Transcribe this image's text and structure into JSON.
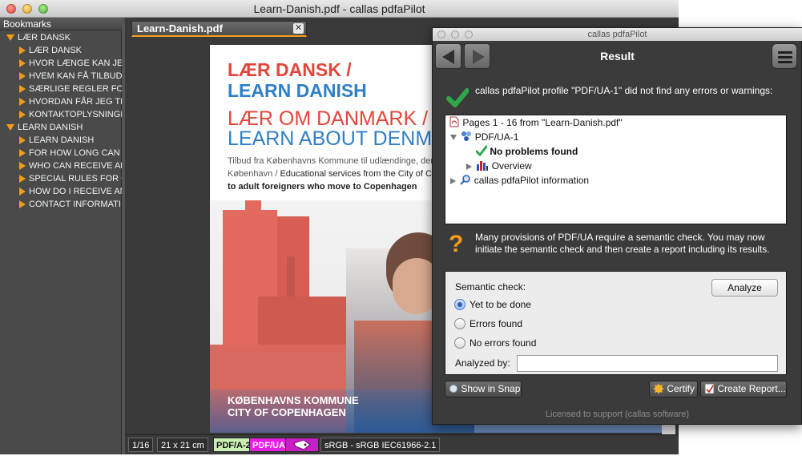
{
  "main_window": {
    "title": "Learn-Danish.pdf - callas pdfaPilot"
  },
  "bookmarks": {
    "header": "Bookmarks",
    "items": [
      {
        "label": "LÆR DANSK",
        "level": 0,
        "expanded": true
      },
      {
        "label": "LÆR DANSK",
        "level": 1,
        "expanded": false
      },
      {
        "label": "HVOR LÆNGE KAN JEG",
        "level": 1,
        "expanded": false
      },
      {
        "label": "HVEM KAN FÅ TILBUD",
        "level": 1,
        "expanded": false
      },
      {
        "label": "SÆRLIGE REGLER FOR",
        "level": 1,
        "expanded": false
      },
      {
        "label": "HVORDAN FÅR JEG TI",
        "level": 1,
        "expanded": false
      },
      {
        "label": "KONTAKTOPLYSNINGI",
        "level": 1,
        "expanded": false
      },
      {
        "label": "LEARN DANISH",
        "level": 0,
        "expanded": true
      },
      {
        "label": "LEARN DANISH",
        "level": 1,
        "expanded": false
      },
      {
        "label": "FOR HOW LONG CAN",
        "level": 1,
        "expanded": false
      },
      {
        "label": "WHO CAN RECEIVE AN",
        "level": 1,
        "expanded": false
      },
      {
        "label": "SPECIAL RULES FOR C",
        "level": 1,
        "expanded": false
      },
      {
        "label": "HOW DO I RECEIVE AN",
        "level": 1,
        "expanded": false
      },
      {
        "label": "CONTACT INFORMATI",
        "level": 1,
        "expanded": false
      }
    ]
  },
  "document": {
    "tab_label": "Learn-Danish.pdf",
    "tab_close": "✕",
    "page": {
      "title_line1": "LÆR DANSK /",
      "title_line2": "LEARN DANISH",
      "sub_line1": "LÆR OM DANMARK /",
      "sub_line2": "LEARN ABOUT DENMA",
      "body_line1": "Tilbud fra Københavns Kommune til udlændinge, der fl",
      "body_line2_a": "København / ",
      "body_line2_b": "Educational services from the City of Co",
      "body_line3": "to adult foreigners who move to Copenhagen",
      "kommune_line1": "KØBENHAVNS KOMMUNE",
      "kommune_line2": "CITY OF COPENHAGEN"
    },
    "colors": {
      "title_red": "#e2453c",
      "title_blue": "#2f7fc7",
      "photo_red": "#e26a5f"
    }
  },
  "status_bar": {
    "page": "1/16",
    "size": "21 x 21 cm",
    "badge_pdfa": "PDF/A-2a",
    "badge_pdfua": "PDF/UA-1",
    "color_profile": "sRGB - sRGB IEC61966-2.1",
    "colors": {
      "pdfa_bg": "#c8f0b4",
      "pdfua_bg": "#e41fe0",
      "tag_bg": "#c81ec4"
    }
  },
  "dialog": {
    "window_title": "callas pdfaPilot",
    "header_title": "Result",
    "success_message": "callas pdfaPilot profile \"PDF/UA-1\" did not find any errors or warnings:",
    "tree": [
      {
        "label": "Pages 1 - 16 from \"Learn-Danish.pdf\"",
        "icon": "pdf-file-icon"
      },
      {
        "label": "PDF/UA-1",
        "icon": "profile-icon"
      },
      {
        "label": "No problems found",
        "icon": "check-icon"
      },
      {
        "label": "Overview",
        "icon": "chart-icon"
      },
      {
        "label": "callas pdfaPilot information",
        "icon": "magnifier-icon"
      }
    ],
    "semantic_message_line1": "Many provisions of PDF/UA require a semantic check. You may now",
    "semantic_message_line2": "initiate the semantic check and then create a report including its results.",
    "semantic": {
      "label": "Semantic check:",
      "analyze_button": "Analyze",
      "options": [
        {
          "label": "Yet to be done",
          "selected": true
        },
        {
          "label": "Errors found",
          "selected": false
        },
        {
          "label": "No errors found",
          "selected": false
        }
      ],
      "analyzed_by_label": "Analyzed by:",
      "analyzed_by_value": ""
    },
    "buttons": {
      "show_in_snap": "Show in Snap",
      "certify": "Certify",
      "create_report": "Create Report..."
    },
    "license": "Licensed to support (callas software)",
    "colors": {
      "check_green": "#2ea84a",
      "question_orange": "#f39c1a"
    }
  }
}
